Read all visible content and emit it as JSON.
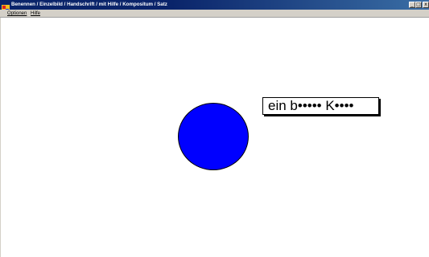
{
  "window": {
    "title": "Benennen / Einzelbild / Handschrift / mit Hilfe / Kompositum / Satz",
    "app_icon": "app-icon",
    "buttons": {
      "minimize": "_",
      "maximize": "□",
      "close": "x"
    }
  },
  "menu": {
    "items": [
      "Optionen",
      "Hilfe"
    ]
  },
  "stage": {
    "shape": "circle",
    "shape_color": "#0000ff",
    "answer_text": "ein b••••• K••••"
  },
  "colors": {
    "titlebar": "#0a246a",
    "chrome": "#d4d0c8"
  }
}
